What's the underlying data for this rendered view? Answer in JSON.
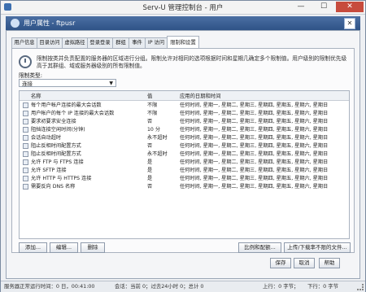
{
  "window": {
    "title": "Serv-U 管理控制台 - 用户",
    "min": "—",
    "max": "☐",
    "close": "✕"
  },
  "dialog": {
    "title": "用户属性 - ftpusr",
    "close": "✕"
  },
  "tabs": [
    "用户信息",
    "目录访问",
    "虚拟路径",
    "登录登录",
    "群组",
    "事件",
    "IP 访问",
    "限制和设置"
  ],
  "panel": {
    "description": "限制按类并负责配置的服务器的区域进行分组。限制允许对相同的选项根据时间和星期几确定多个限制值。用户级别的限制优先级高于其群组、域或服务器级别的所有限制值。",
    "type_label": "限制类型:",
    "type_value": "连接"
  },
  "grid": {
    "headers": [
      "名称",
      "值",
      "应用的日期和时间"
    ],
    "rows": [
      {
        "name": "每个用户帐户连接的最大会话数",
        "value": "不限",
        "when": "任何时间, 星期一, 星期二, 星期三, 星期四, 星期五, 星期六, 星期日"
      },
      {
        "name": "用户帐户的每个 IP 连接的最大会话数",
        "value": "不限",
        "when": "任何时间, 星期一, 星期二, 星期三, 星期四, 星期五, 星期六, 星期日"
      },
      {
        "name": "要求初要求安全连接",
        "value": "否",
        "when": "任何时间, 星期一, 星期二, 星期三, 星期四, 星期五, 星期六, 星期日"
      },
      {
        "name": "阻挡连接空闲时间(分钟)",
        "value": "10 分",
        "when": "任何时间, 星期一, 星期二, 星期三, 星期四, 星期五, 星期六, 星期日"
      },
      {
        "name": "会话自动超时",
        "value": "永不超时",
        "when": "任何时间, 星期一, 星期二, 星期三, 星期四, 星期五, 星期六, 星期日"
      },
      {
        "name": "阻止反相时间配置方式",
        "value": "否",
        "when": "任何时间, 星期一, 星期二, 星期三, 星期四, 星期五, 星期六, 星期日"
      },
      {
        "name": "阻止反相时间配置方式",
        "value": "永不超时",
        "when": "任何时间, 星期一, 星期二, 星期三, 星期四, 星期五, 星期六, 星期日"
      },
      {
        "name": "允许 FTP 与 FTPS 连接",
        "value": "是",
        "when": "任何时间, 星期一, 星期二, 星期三, 星期四, 星期五, 星期六, 星期日"
      },
      {
        "name": "允许 SFTP 连接",
        "value": "是",
        "when": "任何时间, 星期一, 星期二, 星期三, 星期四, 星期五, 星期六, 星期日"
      },
      {
        "name": "允许 HTTP 与 HTTPS 连接",
        "value": "是",
        "when": "任何时间, 星期一, 星期二, 星期三, 星期四, 星期五, 星期六, 星期日"
      },
      {
        "name": "需要反向 DNS 名称",
        "value": "否",
        "when": "任何时间, 星期一, 星期二, 星期三, 星期四, 星期五, 星期六, 星期日"
      }
    ]
  },
  "buttons": {
    "add": "添加...",
    "edit": "编辑...",
    "delete": "删除",
    "compare": "比例和配额...",
    "transfer": "上传/下载率不限的文件...",
    "save": "保存",
    "cancel": "取消",
    "help": "帮助"
  },
  "status": {
    "session_time": "服务器正常运行时间：0 日，00:41:00",
    "sessions": "会话：当前 0；过去24小时 0；总计 0",
    "upload": "上行：0 字节；",
    "download": "下行：0 字节"
  }
}
